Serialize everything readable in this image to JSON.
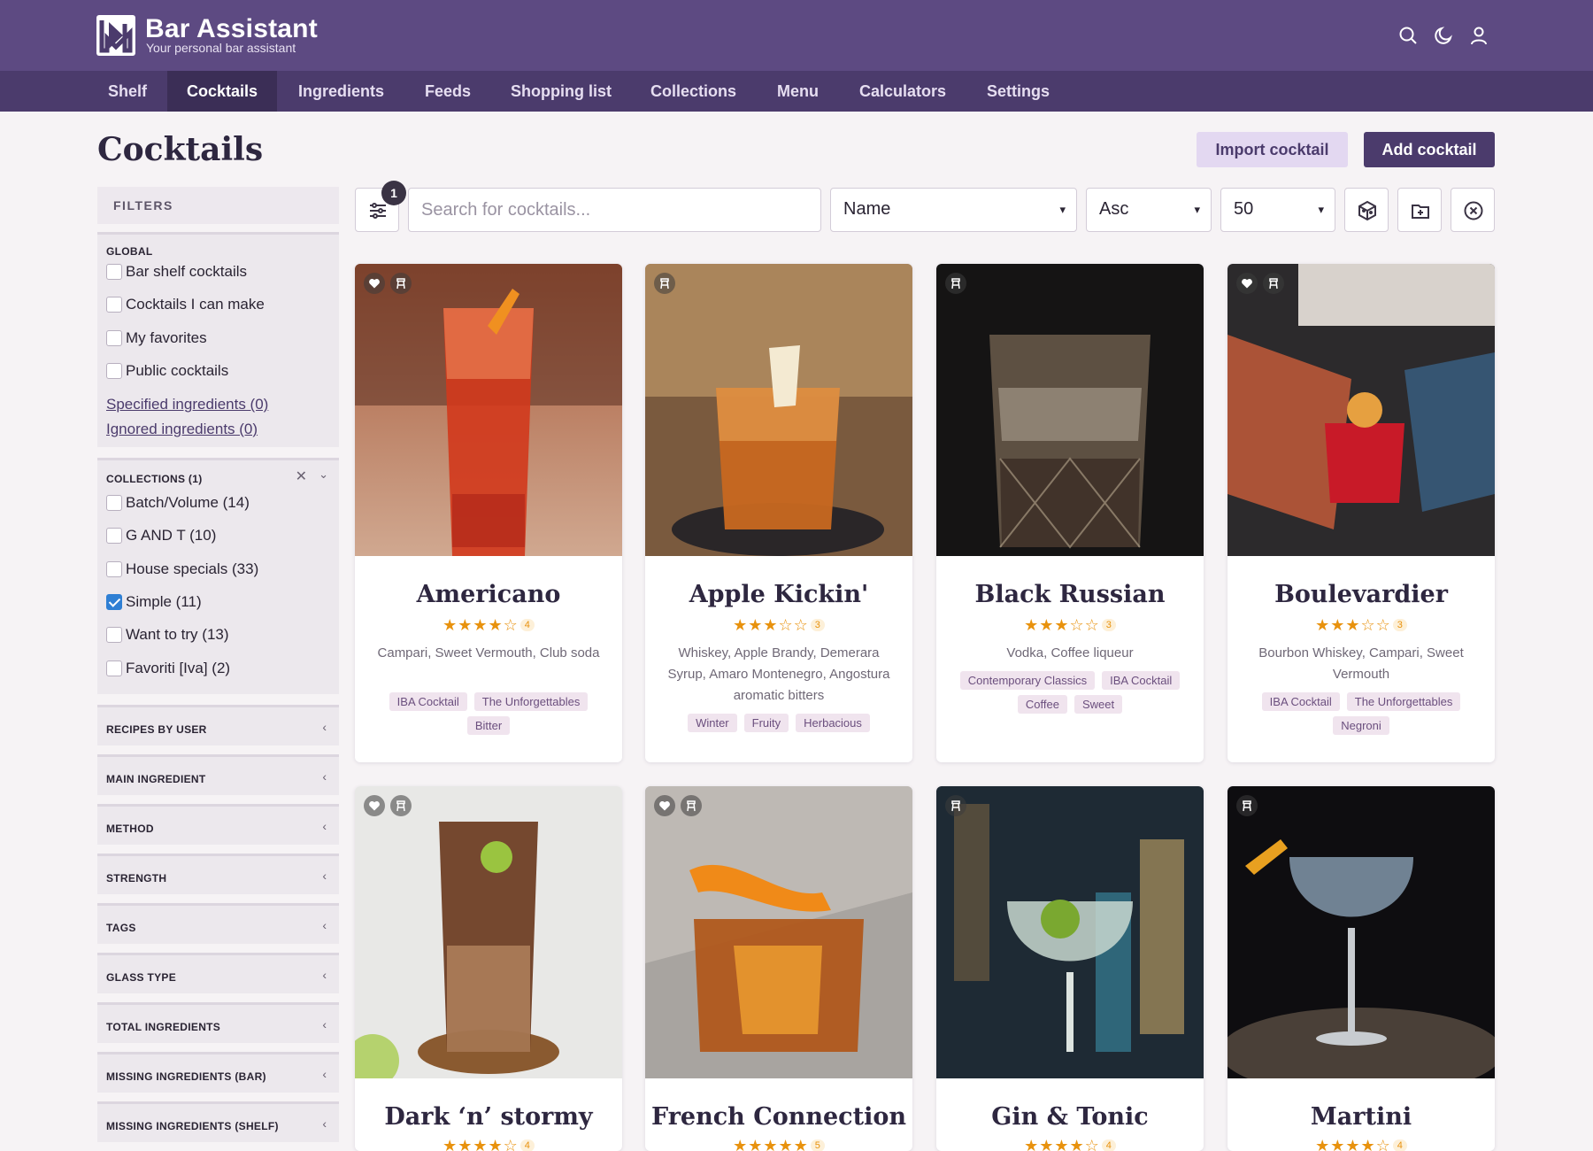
{
  "app": {
    "title": "Bar Assistant",
    "subtitle": "Your personal bar assistant"
  },
  "nav": {
    "items": [
      "Shelf",
      "Cocktails",
      "Ingredients",
      "Feeds",
      "Shopping list",
      "Collections",
      "Menu",
      "Calculators",
      "Settings"
    ],
    "active": "Cocktails"
  },
  "page": {
    "title": "Cocktails",
    "import_label": "Import cocktail",
    "add_label": "Add cocktail"
  },
  "filters": {
    "heading": "FILTERS",
    "global": {
      "label": "GLOBAL",
      "items": [
        "Bar shelf cocktails",
        "Cocktails I can make",
        "My favorites",
        "Public cocktails"
      ],
      "links": [
        "Specified ingredients (0)",
        "Ignored ingredients (0)"
      ]
    },
    "collections": {
      "label": "COLLECTIONS (1)",
      "items": [
        {
          "label": "Batch/Volume (14)",
          "checked": false
        },
        {
          "label": "G AND T (10)",
          "checked": false
        },
        {
          "label": "House specials (33)",
          "checked": false
        },
        {
          "label": "Simple (11)",
          "checked": true
        },
        {
          "label": "Want to try (13)",
          "checked": false
        },
        {
          "label": "Favoriti [Iva] (2)",
          "checked": false
        }
      ]
    },
    "collapsed": [
      "RECIPES BY USER",
      "MAIN INGREDIENT",
      "METHOD",
      "STRENGTH",
      "TAGS",
      "GLASS TYPE",
      "TOTAL INGREDIENTS",
      "MISSING INGREDIENTS (BAR)",
      "MISSING INGREDIENTS (SHELF)"
    ]
  },
  "toolbar": {
    "filter_badge": "1",
    "search_placeholder": "Search for cocktails...",
    "sort": "Name",
    "order": "Asc",
    "per_page": "50"
  },
  "cocktails": [
    {
      "name": "Americano",
      "rating": 4,
      "rating_label": "4",
      "ingredients": "Campari, Sweet Vermouth, Club soda",
      "tags": [
        "IBA Cocktail",
        "The Unforgettables",
        "Bitter"
      ],
      "favorite": true,
      "on_shelf": true
    },
    {
      "name": "Apple Kickin'",
      "rating": 3,
      "rating_label": "3",
      "ingredients": "Whiskey, Apple Brandy, Demerara Syrup, Amaro Montenegro, Angostura aromatic bitters",
      "tags": [
        "Winter",
        "Fruity",
        "Herbacious"
      ],
      "favorite": false,
      "on_shelf": true
    },
    {
      "name": "Black Russian",
      "rating": 3,
      "rating_label": "3",
      "ingredients": "Vodka, Coffee liqueur",
      "tags": [
        "Contemporary Classics",
        "IBA Cocktail",
        "Coffee",
        "Sweet"
      ],
      "favorite": false,
      "on_shelf": true
    },
    {
      "name": "Boulevardier",
      "rating": 3,
      "rating_label": "3",
      "ingredients": "Bourbon Whiskey, Campari, Sweet Vermouth",
      "tags": [
        "IBA Cocktail",
        "The Unforgettables",
        "Negroni"
      ],
      "favorite": true,
      "on_shelf": true
    },
    {
      "name": "Dark ‘n’ stormy",
      "rating": 4,
      "rating_label": "4",
      "ingredients": "",
      "tags": [],
      "favorite": true,
      "on_shelf": true
    },
    {
      "name": "French Connection",
      "rating": 5,
      "rating_label": "5",
      "ingredients": "",
      "tags": [],
      "favorite": true,
      "on_shelf": true
    },
    {
      "name": "Gin & Tonic",
      "rating": 4,
      "rating_label": "4",
      "ingredients": "",
      "tags": [],
      "favorite": false,
      "on_shelf": true
    },
    {
      "name": "Martini",
      "rating": 4,
      "rating_label": "4",
      "ingredients": "",
      "tags": [],
      "favorite": false,
      "on_shelf": true
    }
  ],
  "colors": {
    "header": "#5d4a82",
    "nav": "#4b3b6c",
    "accent": "#4b3b6c",
    "star": "#e8920e",
    "checkbox": "#2f7fd4"
  }
}
